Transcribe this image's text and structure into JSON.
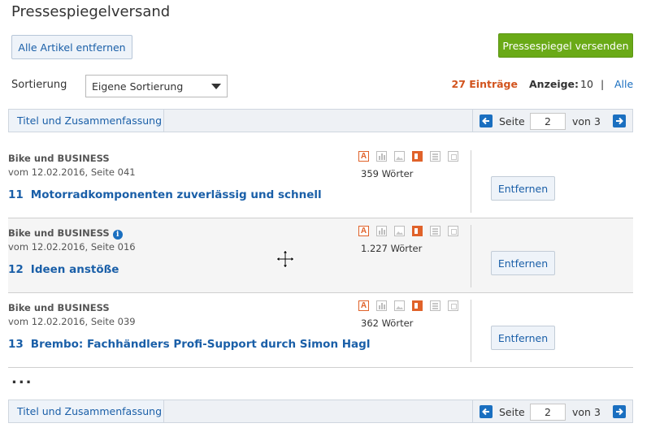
{
  "page": {
    "title": "Pressespiegelversand"
  },
  "toolbar": {
    "remove_all_label": "Alle Artikel entfernen",
    "send_label": "Pressespiegel versenden"
  },
  "sort": {
    "label": "Sortierung",
    "selected": "Eigene Sortierung"
  },
  "summary": {
    "count": "27 Einträge",
    "anzeige_label": "Anzeige:",
    "anzeige_value": "10",
    "separator": "|",
    "all_label": "Alle"
  },
  "pager": {
    "tab_label": "Titel und Zusammenfassung",
    "seite_label": "Seite",
    "current_page": "2",
    "von_label": "von 3"
  },
  "articles": [
    {
      "source": "Bike und BUSINESS",
      "date": "vom 12.02.2016, Seite 041",
      "number": "11",
      "title": "Motorradkomponenten zuverlässig und schnell",
      "words": "359 Wörter",
      "remove_label": "Entfernen"
    },
    {
      "source": "Bike und BUSINESS",
      "date": "vom 12.02.2016, Seite 016",
      "number": "12",
      "title": "Ideen anstöße",
      "words": "1.227 Wörter",
      "remove_label": "Entfernen"
    },
    {
      "source": "Bike und BUSINESS",
      "date": "vom 12.02.2016, Seite 039",
      "number": "13",
      "title": "Brembo: Fachhändlers Profi-Support durch Simon Hagl",
      "words": "362 Wörter",
      "remove_label": "Entfernen"
    }
  ],
  "article_icons": {
    "text_icon": "A",
    "names": [
      "text-icon",
      "chart-icon",
      "image-icon",
      "layout-icon",
      "grid-icon",
      "excel-icon"
    ]
  },
  "info_icon_glyph": "i",
  "more": "...",
  "colors": {
    "accent_blue": "#1a6fc0",
    "send_green": "#6aaa17",
    "count_orange": "#d2541e"
  }
}
